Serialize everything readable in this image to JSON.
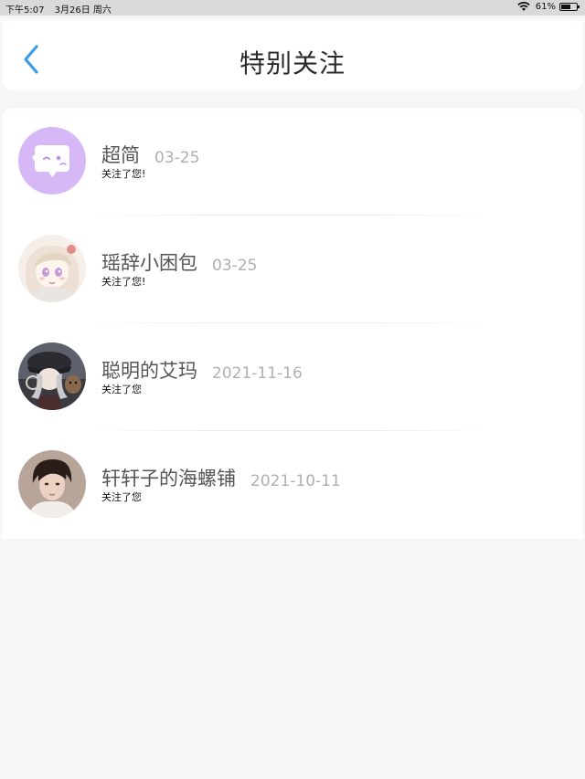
{
  "status_bar": {
    "time": "下午5:07",
    "date": "3月26日 周六",
    "battery": "61%",
    "battery_level": 0.61
  },
  "header": {
    "title": "特别关注",
    "back_icon": "chevron-left-icon",
    "accent_color": "#3b9de8"
  },
  "follows": [
    {
      "name": "超简",
      "date": "03-25",
      "message": "关注了您!"
    },
    {
      "name": "瑶辞小困包",
      "date": "03-25",
      "message": "关注了您!"
    },
    {
      "name": "聪明的艾玛",
      "date": "2021-11-16",
      "message": "关注了您"
    },
    {
      "name": "轩轩子的海螺铺",
      "date": "2021-10-11",
      "message": "关注了您"
    }
  ]
}
